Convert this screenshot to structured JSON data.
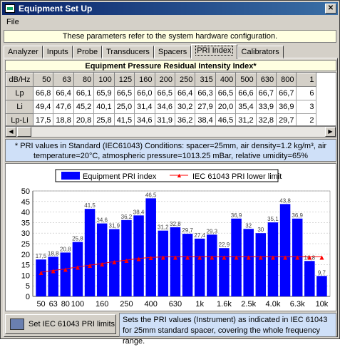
{
  "window": {
    "title": "Equipment Set Up"
  },
  "menu": {
    "file": "File"
  },
  "info": "These parameters refer to the system hardware configuration.",
  "tabs": [
    "Analyzer",
    "Inputs",
    "Probe",
    "Transducers",
    "Spacers",
    "PRI Index",
    "Calibrators"
  ],
  "active_tab": "PRI Index",
  "table": {
    "title": "Equipment Pressure Residual Intensity Index*",
    "corner": "dB/Hz",
    "freqs": [
      "50",
      "63",
      "80",
      "100",
      "125",
      "160",
      "200",
      "250",
      "315",
      "400",
      "500",
      "630",
      "800",
      "1"
    ],
    "rows": [
      {
        "label": "Lp",
        "values": [
          "66,8",
          "66,4",
          "66,1",
          "65,9",
          "66,5",
          "66,0",
          "66,5",
          "66,4",
          "66,3",
          "66,5",
          "66,6",
          "66,7",
          "66,7",
          "6"
        ]
      },
      {
        "label": "Li",
        "values": [
          "49,4",
          "47,6",
          "45,2",
          "40,1",
          "25,0",
          "31,4",
          "34,6",
          "30,2",
          "27,9",
          "20,0",
          "35,4",
          "33,9",
          "36,9",
          "3"
        ]
      },
      {
        "label": "Lp-Li",
        "values": [
          "17,5",
          "18,8",
          "20,8",
          "25,8",
          "41,5",
          "34,6",
          "31,9",
          "36,2",
          "38,4",
          "46,5",
          "31,2",
          "32,8",
          "29,7",
          "2"
        ]
      }
    ]
  },
  "note": "* PRI values in Standard (IEC61043) Conditions: spacer=25mm, air density=1.2 kg/m³, air temperature=20°C, atmospheric pressure=1013.25 mBar, relative umidity=65%",
  "chart_data": {
    "type": "bar",
    "series": [
      {
        "name": "Equipment PRI index",
        "color": "#0000ff",
        "values": [
          17.5,
          18.8,
          20.8,
          25.8,
          41.5,
          34.6,
          31.9,
          36.2,
          38.4,
          46.5,
          31.2,
          32.8,
          29.7,
          27.4,
          29.3,
          22.9,
          36.9,
          32,
          30,
          35.1,
          43.8,
          36.9,
          16.8,
          9.7
        ]
      },
      {
        "name": "IEC 61043 PRI lower limit",
        "color": "#ff0000",
        "type": "line",
        "values": [
          11.5,
          12.3,
          13,
          14,
          14.8,
          15.6,
          16.5,
          17.2,
          18,
          18.5,
          18.7,
          18.8,
          18.8,
          18.8,
          18.8,
          18.8,
          18.8,
          18.8,
          18.8,
          18.8,
          18.8,
          18.8,
          18.8,
          18.8
        ]
      }
    ],
    "data_labels": [
      "17,5",
      "18,8",
      "20,8",
      "25,8",
      "41,5",
      "34,6",
      "31,9",
      "36,2",
      "38,4",
      "46,5",
      "31,2",
      "32,8",
      "29,7",
      "27,4",
      "29,3",
      "22,9",
      "36,9",
      "32",
      "30",
      "35,1",
      "43,8",
      "36,9",
      "16,8",
      "9,7"
    ],
    "x_tick_labels": [
      "50",
      "63",
      "80",
      "100",
      "",
      "160",
      "",
      "250",
      "",
      "400",
      "",
      "630",
      "",
      "1k",
      "",
      "1.6k",
      "",
      "2.5k",
      "",
      "4.0k",
      "",
      "6.3k",
      "",
      "10k"
    ],
    "y_ticks": [
      "0",
      "5",
      "10",
      "15",
      "20",
      "25",
      "30",
      "35",
      "40",
      "45",
      "50"
    ],
    "ylim": [
      0,
      50
    ],
    "legend_position": "top"
  },
  "set_button": "Set IEC 61043 PRI limits",
  "tip": "Sets the PRI values (Instrument) as indicated in IEC 61043 for 25mm standard spacer, covering the whole frequency range."
}
